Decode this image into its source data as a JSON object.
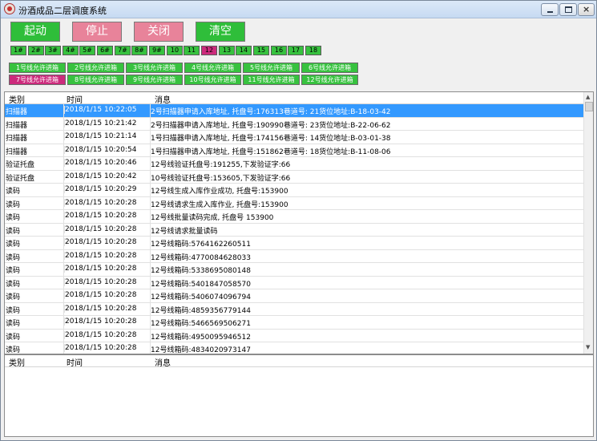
{
  "window": {
    "title": "汾酒成品二层调度系统"
  },
  "controls": {
    "start": "起动",
    "stop": "停止",
    "close": "关闭",
    "clear": "清空"
  },
  "numbers": [
    {
      "label": "1#",
      "state": "green"
    },
    {
      "label": "2#",
      "state": "green"
    },
    {
      "label": "3#",
      "state": "green"
    },
    {
      "label": "4#",
      "state": "green"
    },
    {
      "label": "5#",
      "state": "green"
    },
    {
      "label": "6#",
      "state": "green"
    },
    {
      "label": "7#",
      "state": "green"
    },
    {
      "label": "8#",
      "state": "green"
    },
    {
      "label": "9#",
      "state": "green"
    },
    {
      "label": "10",
      "state": "green"
    },
    {
      "label": "11",
      "state": "green"
    },
    {
      "label": "12",
      "state": "magenta"
    },
    {
      "label": "13",
      "state": "green"
    },
    {
      "label": "14",
      "state": "green"
    },
    {
      "label": "15",
      "state": "green"
    },
    {
      "label": "16",
      "state": "green"
    },
    {
      "label": "17",
      "state": "green"
    },
    {
      "label": "18",
      "state": "green"
    }
  ],
  "line_buttons_row1": [
    {
      "label": "1号线允许进箱",
      "state": "green"
    },
    {
      "label": "2号线允许进箱",
      "state": "green"
    },
    {
      "label": "3号线允许进箱",
      "state": "green"
    },
    {
      "label": "4号线允许进箱",
      "state": "green"
    },
    {
      "label": "5号线允许进箱",
      "state": "green"
    },
    {
      "label": "6号线允许进箱",
      "state": "green"
    }
  ],
  "line_buttons_row2": [
    {
      "label": "7号线允许进箱",
      "state": "magenta"
    },
    {
      "label": "8号线允许进箱",
      "state": "green"
    },
    {
      "label": "9号线允许进箱",
      "state": "green"
    },
    {
      "label": "10号线允许进箱",
      "state": "green"
    },
    {
      "label": "11号线允许进箱",
      "state": "green"
    },
    {
      "label": "12号线允许进箱",
      "state": "green"
    }
  ],
  "log_grid": {
    "headers": [
      "类别",
      "时间",
      "消息"
    ],
    "rows": [
      {
        "type": "扫描器",
        "time": "2018/1/15 10:22:05",
        "msg": "2号扫描器申请入库地址, 托盘号:176313巷道号: 21货位地址:B-18-03-42",
        "selected": true
      },
      {
        "type": "扫描器",
        "time": "2018/1/15 10:21:42",
        "msg": "2号扫描器申请入库地址, 托盘号:190990巷道号: 23货位地址:B-22-06-62"
      },
      {
        "type": "扫描器",
        "time": "2018/1/15 10:21:14",
        "msg": "1号扫描器申请入库地址, 托盘号:174156巷道号: 14货位地址:B-03-01-38"
      },
      {
        "type": "扫描器",
        "time": "2018/1/15 10:20:54",
        "msg": "1号扫描器申请入库地址, 托盘号:151862巷道号: 18货位地址:B-11-08-06"
      },
      {
        "type": "验证托盘",
        "time": "2018/1/15 10:20:46",
        "msg": "12号线验证托盘号:191255,下发验证字:66"
      },
      {
        "type": "验证托盘",
        "time": "2018/1/15 10:20:42",
        "msg": "10号线验证托盘号:153605,下发验证字:66"
      },
      {
        "type": "读码",
        "time": "2018/1/15 10:20:29",
        "msg": "12号线生成入库作业成功, 托盘号:153900"
      },
      {
        "type": "读码",
        "time": "2018/1/15 10:20:28",
        "msg": "12号线请求生成入库作业, 托盘号:153900"
      },
      {
        "type": "读码",
        "time": "2018/1/15 10:20:28",
        "msg": "12号线批量读码完成, 托盘号 153900"
      },
      {
        "type": "读码",
        "time": "2018/1/15 10:20:28",
        "msg": "12号线请求批量读码"
      },
      {
        "type": "读码",
        "time": "2018/1/15 10:20:28",
        "msg": "12号线箱码:5764162260511"
      },
      {
        "type": "读码",
        "time": "2018/1/15 10:20:28",
        "msg": "12号线箱码:4770084628033"
      },
      {
        "type": "读码",
        "time": "2018/1/15 10:20:28",
        "msg": "12号线箱码:5338695080148"
      },
      {
        "type": "读码",
        "time": "2018/1/15 10:20:28",
        "msg": "12号线箱码:5401847058570"
      },
      {
        "type": "读码",
        "time": "2018/1/15 10:20:28",
        "msg": "12号线箱码:5406074096794"
      },
      {
        "type": "读码",
        "time": "2018/1/15 10:20:28",
        "msg": "12号线箱码:4859356779144"
      },
      {
        "type": "读码",
        "time": "2018/1/15 10:20:28",
        "msg": "12号线箱码:5466569506271"
      },
      {
        "type": "读码",
        "time": "2018/1/15 10:20:28",
        "msg": "12号线箱码:4950095946512"
      },
      {
        "type": "读码",
        "time": "2018/1/15 10:20:28",
        "msg": "12号线箱码:4834020973147"
      }
    ]
  },
  "second_grid": {
    "headers": [
      "类别",
      "时间",
      "消息"
    ]
  },
  "colors": {
    "green": "#37c23f",
    "magenta": "#cc2a7c",
    "pink": "#e8839a",
    "selected": "#3399ff"
  }
}
